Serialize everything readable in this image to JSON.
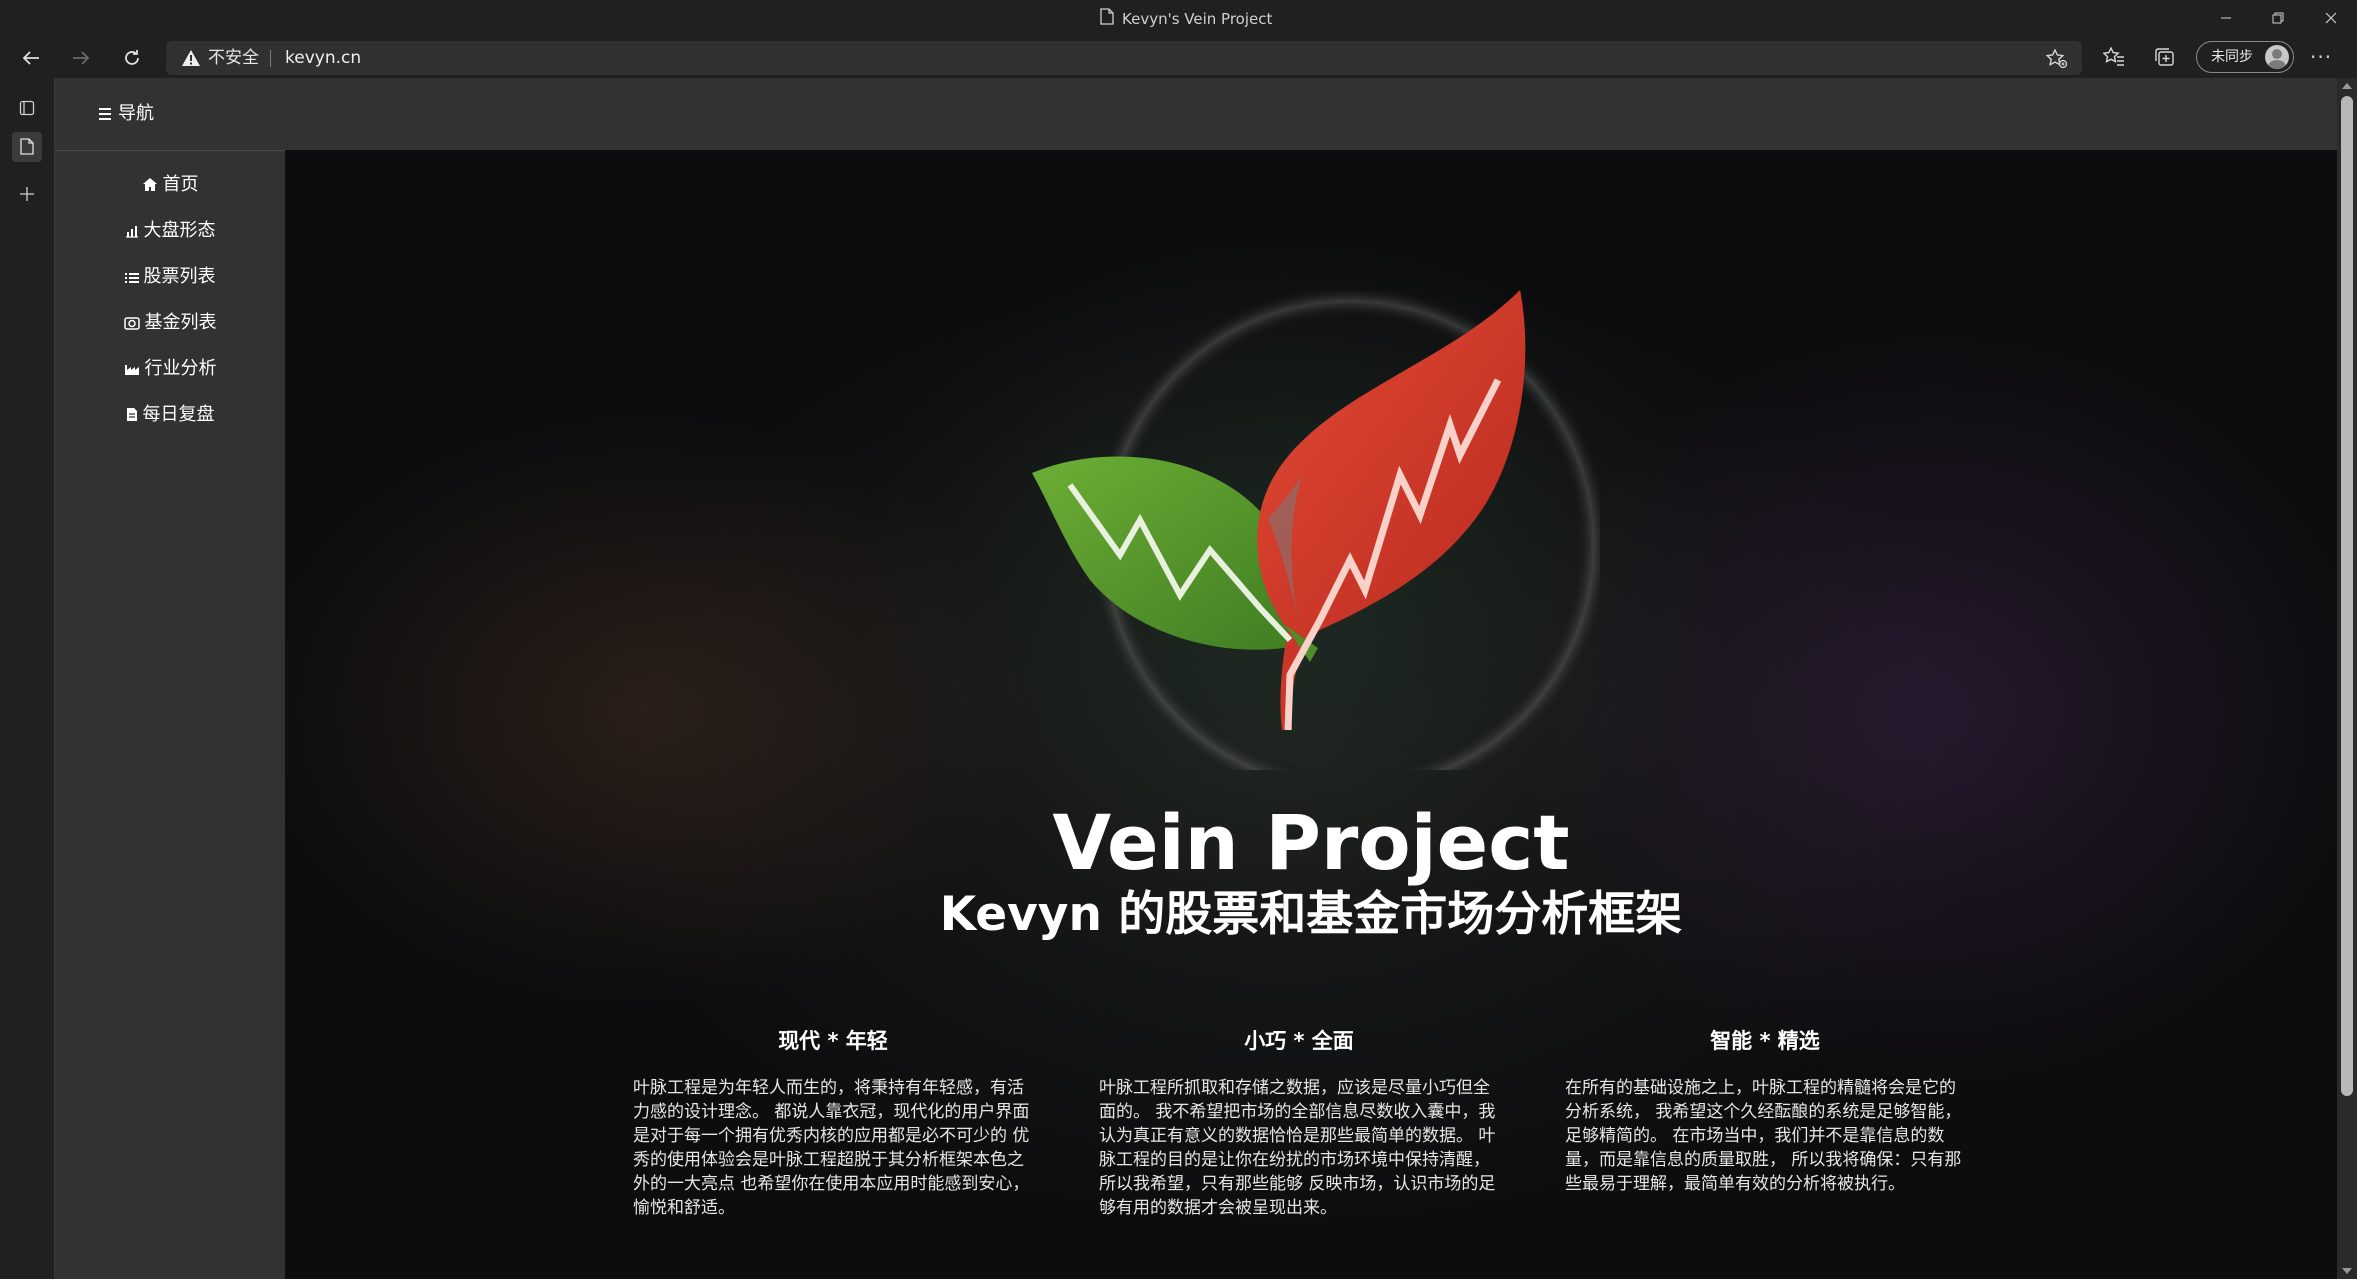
{
  "window": {
    "title": "Kevyn's Vein Project"
  },
  "toolbar": {
    "security_label": "不安全",
    "url": "kevyn.cn",
    "profile_label": "未同步",
    "more_label": "···"
  },
  "site": {
    "nav_toggle_label": "导航",
    "sidebar": {
      "items": [
        {
          "label": "首页",
          "icon": "home-icon"
        },
        {
          "label": "大盘形态",
          "icon": "bar-chart-icon"
        },
        {
          "label": "股票列表",
          "icon": "list-icon"
        },
        {
          "label": "基金列表",
          "icon": "camera-icon"
        },
        {
          "label": "行业分析",
          "icon": "industry-icon"
        },
        {
          "label": "每日复盘",
          "icon": "document-icon"
        }
      ]
    },
    "hero": {
      "title": "Vein Project",
      "subtitle": "Kevyn 的股票和基金市场分析框架"
    },
    "features": [
      {
        "title": "现代 * 年轻",
        "body": "叶脉工程是为年轻人而生的，将秉持有年轻感，有活力感的设计理念。 都说人靠衣冠，现代化的用户界面是对于每一个拥有优秀内核的应用都是必不可少的 优秀的使用体验会是叶脉工程超脱于其分析框架本色之外的一大亮点 也希望你在使用本应用时能感到安心，愉悦和舒适。"
      },
      {
        "title": "小巧 * 全面",
        "body": "叶脉工程所抓取和存储之数据，应该是尽量小巧但全面的。 我不希望把市场的全部信息尽数收入囊中，我认为真正有意义的数据恰恰是那些最简单的数据。 叶脉工程的目的是让你在纷扰的市场环境中保持清醒， 所以我希望，只有那些能够 反映市场，认识市场的足够有用的数据才会被呈现出来。"
      },
      {
        "title": "智能 * 精选",
        "body": "在所有的基础设施之上，叶脉工程的精髓将会是它的分析系统， 我希望这个久经酝酿的系统是足够智能，足够精简的。 在市场当中，我们并不是靠信息的数量，而是靠信息的质量取胜， 所以我将确保：只有那些最易于理解，最简单有效的分析将被执行。"
      }
    ]
  },
  "colors": {
    "leaf_red": "#d9382a",
    "leaf_green": "#5a9a2e",
    "chrome_bg": "#202020",
    "sidebar_bg": "#323232"
  }
}
